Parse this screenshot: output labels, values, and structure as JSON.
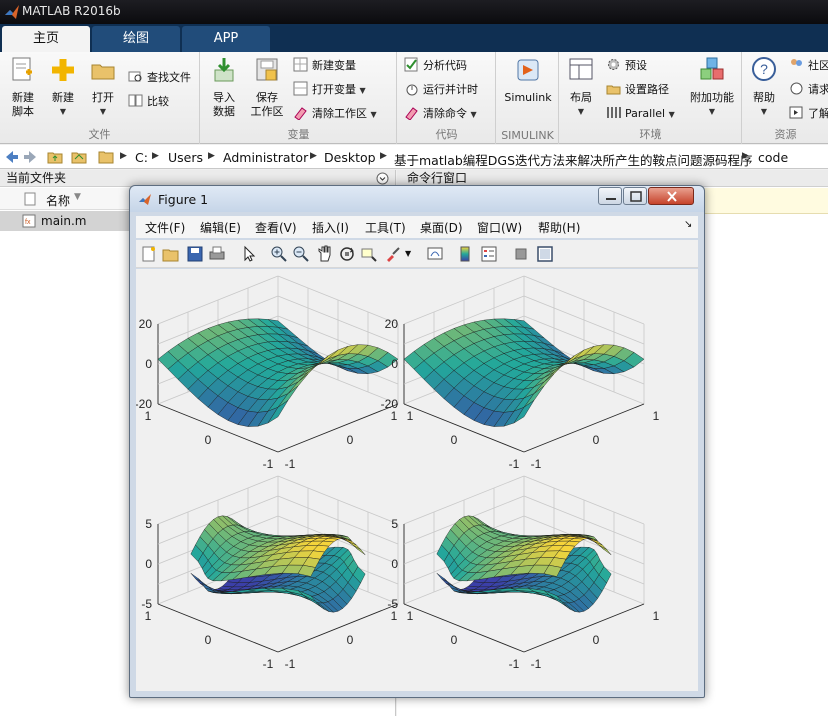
{
  "app": {
    "title": "MATLAB R2016b"
  },
  "tabs": [
    "主页",
    "绘图",
    "APP"
  ],
  "ribbon": {
    "file": {
      "label": "文件",
      "new_script": [
        "新建",
        "脚本"
      ],
      "new": "新建",
      "open": "打开",
      "find_files": "查找文件",
      "compare": "比较"
    },
    "variable": {
      "label": "变量",
      "import": [
        "导入",
        "数据"
      ],
      "save_ws": [
        "保存",
        "工作区"
      ],
      "new_var": "新建变量",
      "open_var": "打开变量",
      "clear_ws": "清除工作区"
    },
    "code": {
      "label": "代码",
      "analyze": "分析代码",
      "run_time": "运行并计时",
      "clear_cmd": "清除命令"
    },
    "simulink": {
      "label": "SIMULINK",
      "simulink": "Simulink"
    },
    "env": {
      "label": "环境",
      "layout": "布局",
      "prefs": "预设",
      "set_path": "设置路径",
      "parallel": "Parallel",
      "addons": "附加功能"
    },
    "resources": {
      "label": "资源",
      "help": "帮助",
      "community": "社区",
      "request": "请求",
      "learn": "了解"
    }
  },
  "address": {
    "path": [
      "C:",
      "Users",
      "Administrator",
      "Desktop",
      "基于matlab编程DGS迭代方法来解决所产生的鞍点问题源码程序",
      "code"
    ]
  },
  "file_panel": {
    "title": "当前文件夹",
    "column_name": "名称",
    "files": [
      "main.m"
    ]
  },
  "cmd_panel": {
    "title": "命令行窗口"
  },
  "figure": {
    "title": "Figure 1",
    "menu": [
      "文件(F)",
      "编辑(E)",
      "查看(V)",
      "插入(I)",
      "工具(T)",
      "桌面(D)",
      "窗口(W)",
      "帮助(H)"
    ],
    "plots": [
      {
        "ztick": [
          "20",
          "0",
          "-20"
        ],
        "ytick": [
          "1",
          "0",
          "-1"
        ],
        "xtick": [
          "-1",
          "0",
          "1"
        ]
      },
      {
        "ztick": [
          "20",
          "0",
          "-20"
        ],
        "ytick": [
          "1",
          "0",
          "-1"
        ],
        "xtick": [
          "-1",
          "0",
          "1"
        ]
      },
      {
        "ztick": [
          "5",
          "0",
          "-5"
        ],
        "ytick": [
          "1",
          "0",
          "-1"
        ],
        "xtick": [
          "-1",
          "0",
          "1"
        ]
      },
      {
        "ztick": [
          "5",
          "0",
          "-5"
        ],
        "ytick": [
          "1",
          "0",
          "-1"
        ],
        "xtick": [
          "-1",
          "0",
          "1"
        ]
      }
    ]
  },
  "colors": {
    "matlab_tab_bar": "#0f2f52",
    "surface_low": "#3b3fa8",
    "surface_mid": "#23a89b",
    "surface_high": "#f5d43b"
  }
}
